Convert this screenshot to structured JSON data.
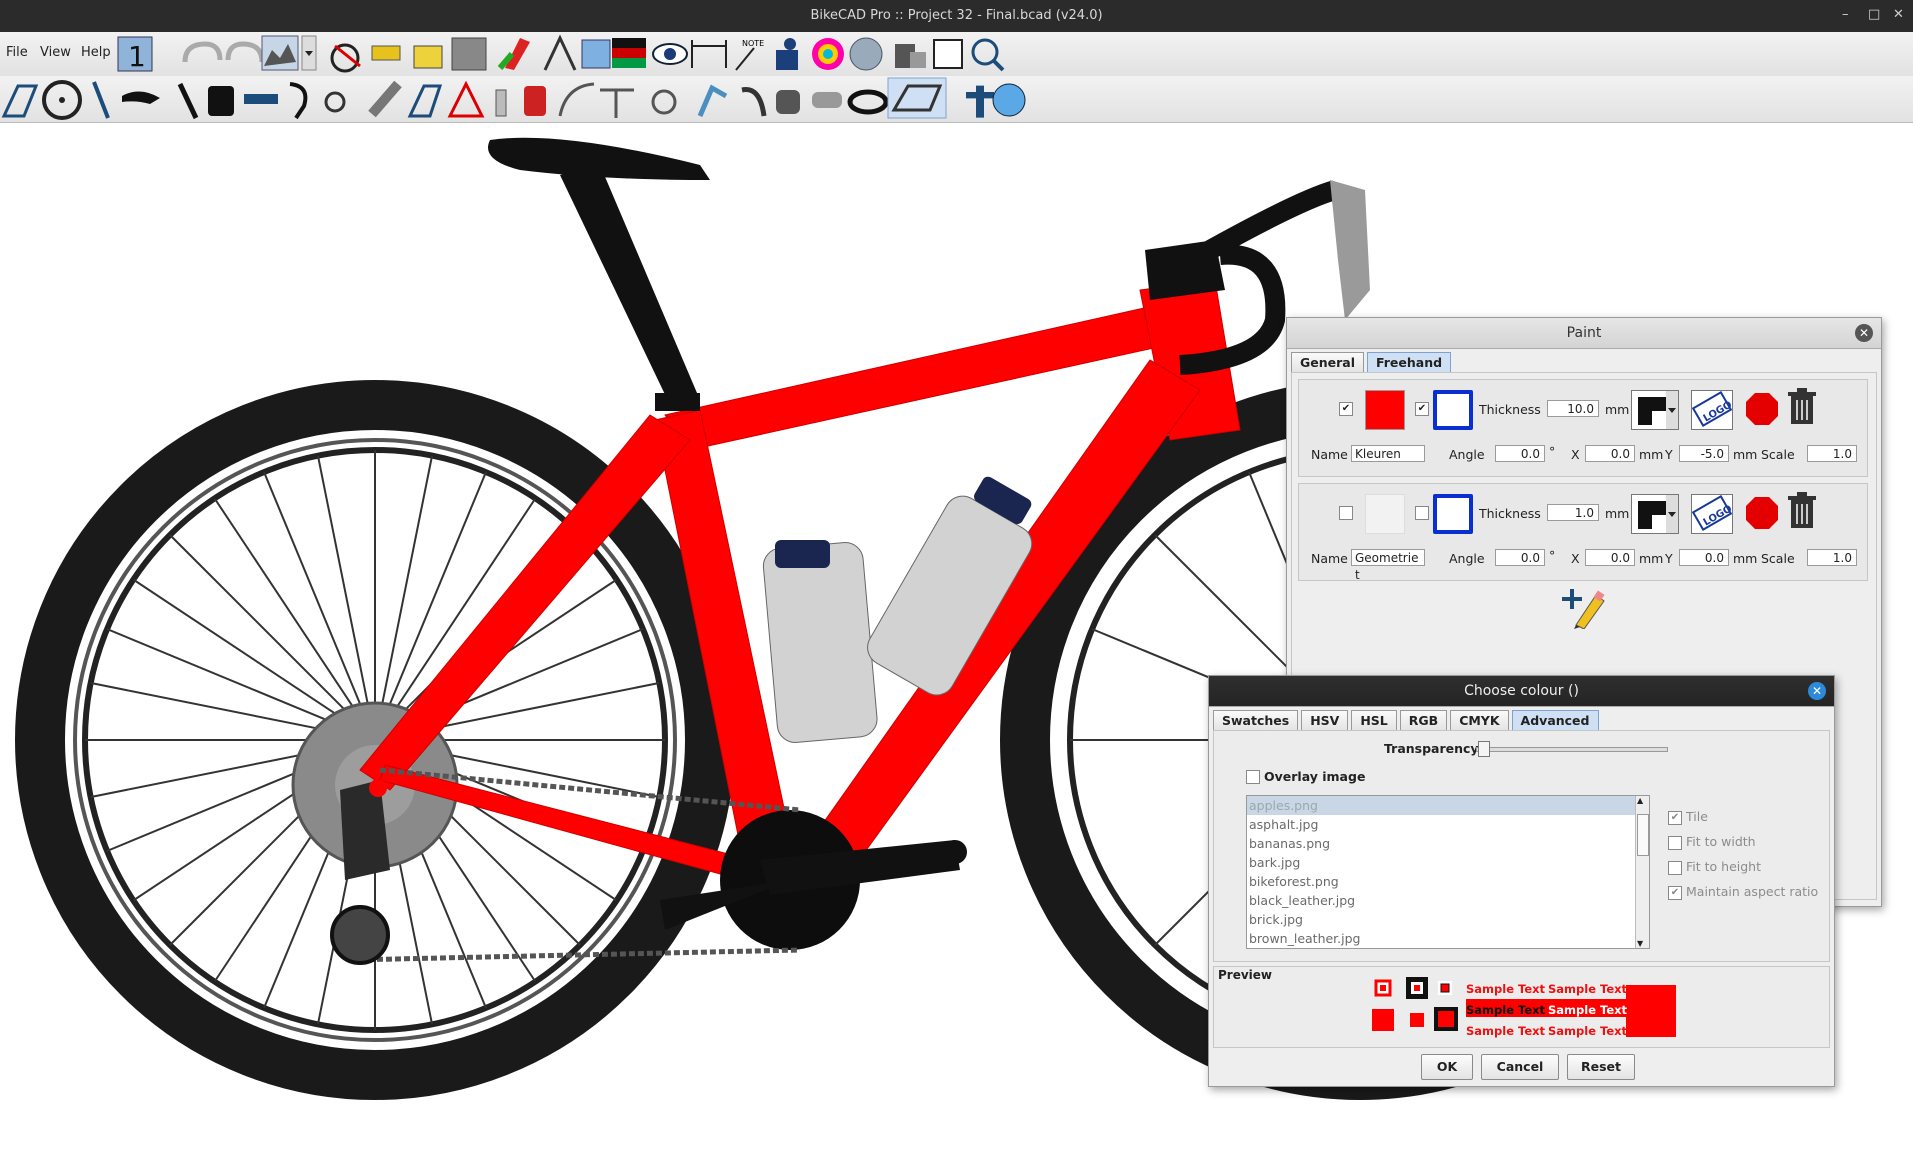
{
  "window": {
    "title": "BikeCAD Pro :: Project 32 - Final.bcad (v24.0)"
  },
  "menu": {
    "file": "File",
    "view": "View",
    "help": "Help"
  },
  "toolbar": {
    "note_label": "NOTE"
  },
  "paint": {
    "title": "Paint",
    "tabs": [
      "General",
      "Freehand"
    ],
    "selected_tab": "Freehand",
    "labels": {
      "thickness": "Thickness",
      "mm": "mm",
      "name": "Name",
      "angle": "Angle",
      "deg": "°",
      "x": "X",
      "y": "Y",
      "scale": "Scale"
    },
    "layers": [
      {
        "fill_checked": true,
        "stroke_checked": true,
        "fill_color": "#ff0000",
        "thickness": "10.0",
        "name": "Kleuren",
        "angle": "0.0",
        "x": "0.0",
        "y": "-5.0",
        "scale": "1.0"
      },
      {
        "fill_checked": false,
        "stroke_checked": false,
        "fill_color": "#f2f2f2",
        "thickness": "1.0",
        "name": "Geometrie t",
        "angle": "0.0",
        "x": "0.0",
        "y": "0.0",
        "scale": "1.0"
      }
    ],
    "logo_text": "LOGO"
  },
  "colour": {
    "title": "Choose colour ()",
    "tabs": [
      "Swatches",
      "HSV",
      "HSL",
      "RGB",
      "CMYK",
      "Advanced"
    ],
    "selected_tab": "Advanced",
    "transparency_label": "Transparency",
    "overlay_label": "Overlay image",
    "files": [
      "apples.png",
      "asphalt.jpg",
      "bananas.png",
      "bark.jpg",
      "bikeforest.png",
      "black_leather.jpg",
      "brick.jpg",
      "brown_leather.jpg"
    ],
    "options": [
      {
        "label": "Tile",
        "checked": true
      },
      {
        "label": "Fit to width",
        "checked": false
      },
      {
        "label": "Fit to height",
        "checked": false
      },
      {
        "label": "Maintain aspect ratio",
        "checked": true
      }
    ],
    "preview_label": "Preview",
    "sample_text": "Sample Text",
    "buttons": {
      "ok": "OK",
      "cancel": "Cancel",
      "reset": "Reset"
    },
    "accent": "#ff0000"
  }
}
